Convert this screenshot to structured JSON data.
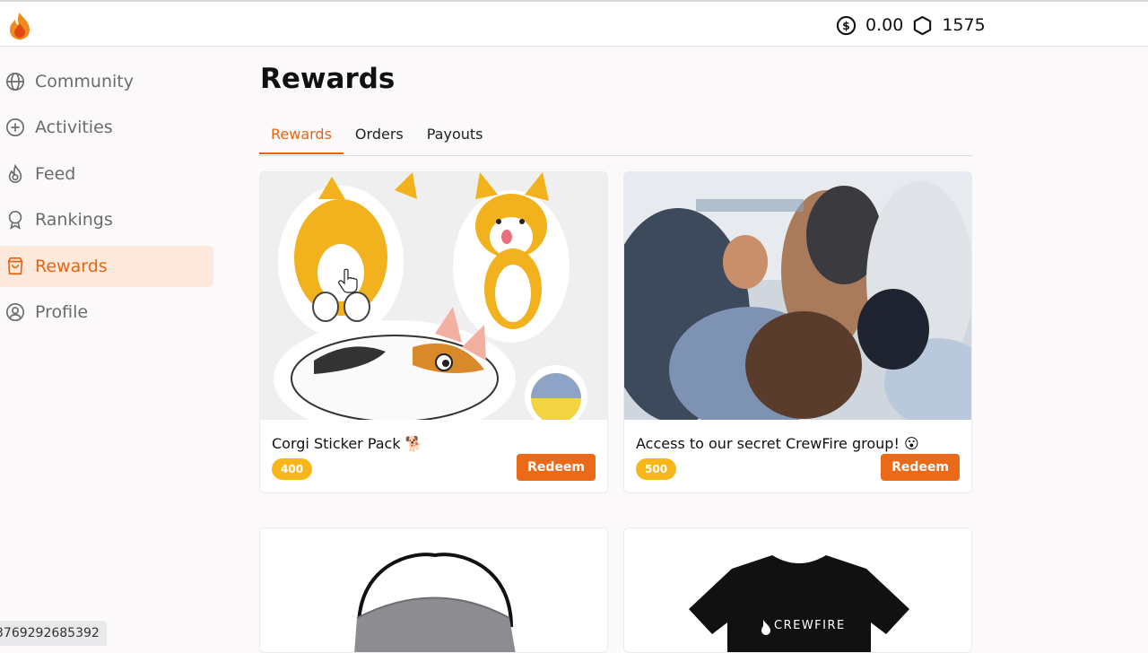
{
  "header": {
    "balance_dollars": "0.00",
    "balance_points": "1575"
  },
  "sidebar": {
    "items": [
      {
        "label": "Community",
        "icon": "globe-icon",
        "active": false
      },
      {
        "label": "Activities",
        "icon": "plus-circle-icon",
        "active": false
      },
      {
        "label": "Feed",
        "icon": "flame-icon",
        "active": false
      },
      {
        "label": "Rankings",
        "icon": "award-icon",
        "active": false
      },
      {
        "label": "Rewards",
        "icon": "shopping-bag-icon",
        "active": true
      },
      {
        "label": "Profile",
        "icon": "user-circle-icon",
        "active": false
      }
    ]
  },
  "main": {
    "title": "Rewards",
    "tabs": [
      {
        "label": "Rewards",
        "active": true
      },
      {
        "label": "Orders",
        "active": false
      },
      {
        "label": "Payouts",
        "active": false
      }
    ]
  },
  "rewards": [
    {
      "name": "Corgi Sticker Pack 🐕",
      "points": "400",
      "redeem_label": "Redeem"
    },
    {
      "name": "Access to our secret CrewFire group! 😮",
      "points": "500",
      "redeem_label": "Redeem"
    },
    {
      "name": "",
      "points": "",
      "redeem_label": ""
    },
    {
      "name": "",
      "points": "",
      "redeem_label": ""
    }
  ],
  "tshirt_print": "CREWFIRE",
  "status_bar": "3769292685392",
  "colors": {
    "accent": "#e8650f",
    "active_nav_bg": "#fde9dc",
    "points_badge": "#f7b71a"
  }
}
